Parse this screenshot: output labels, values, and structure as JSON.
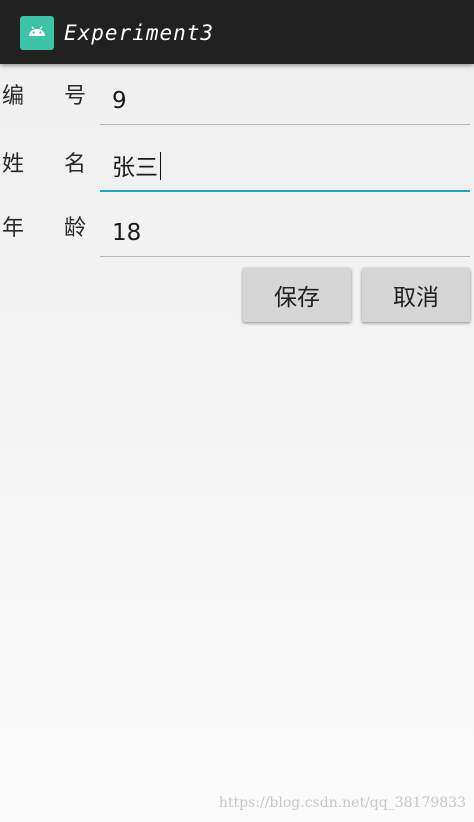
{
  "app": {
    "title": "Experiment3",
    "icon": "android-icon",
    "theme_color": "#212121",
    "icon_color": "#3dc4a6"
  },
  "form": {
    "fields": [
      {
        "label_1": "编",
        "label_2": "号",
        "value": "9"
      },
      {
        "label_1": "姓",
        "label_2": "名",
        "value": "张三",
        "focused": true
      },
      {
        "label_1": "年",
        "label_2": "龄",
        "value": "18"
      }
    ],
    "accent_color": "#23a4c5"
  },
  "buttons": {
    "save": "保存",
    "cancel": "取消"
  },
  "watermark": "https://blog.csdn.net/qq_38179833"
}
